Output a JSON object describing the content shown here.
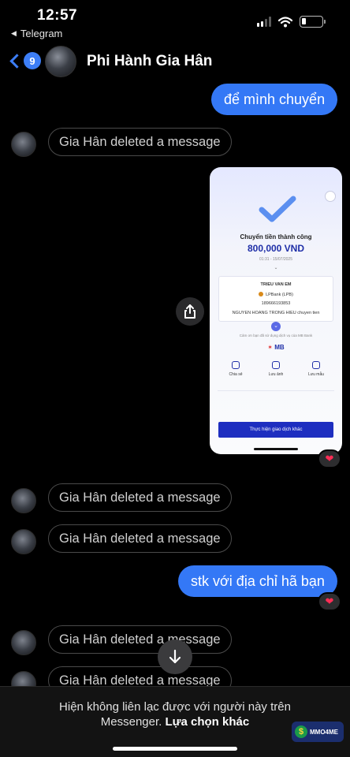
{
  "status_bar": {
    "time": "12:57",
    "back_app": "Telegram"
  },
  "header": {
    "unread_count": "9",
    "contact_name": "Phi Hành Gia Hân"
  },
  "messages": {
    "out_1": "để mình chuyển",
    "deleted_text": "Gia Hân deleted a message",
    "out_2": "stk với địa chỉ hã bạn",
    "reaction": "❤"
  },
  "receipt": {
    "title": "Chuyển tiền thành công",
    "amount": "800,000 VND",
    "time": "01:31 - 15/07/2025",
    "recipient": "TRIEU VAN EM",
    "bank": "LPBank (LPB)",
    "account": "189666193853",
    "note": "NGUYEN HOANG TRONG HIEU chuyen tien",
    "thanks": "Cảm ơn bạn đã sử dụng dịch vụ của MB Bank",
    "brand": "MB",
    "actions": [
      "Chia sẻ",
      "Lưu ảnh",
      "Lưu mẫu"
    ],
    "cta": "Thực hiện giao dịch khác"
  },
  "footer": {
    "notice_line1": "Hiện không liên lạc được với người này trên",
    "notice_line2": "Messenger.",
    "notice_option": "Lựa chọn khác",
    "watermark": "MMO4ME"
  },
  "colors": {
    "accent": "#3478f6",
    "background": "#000000",
    "heart": "#ff2d55"
  }
}
